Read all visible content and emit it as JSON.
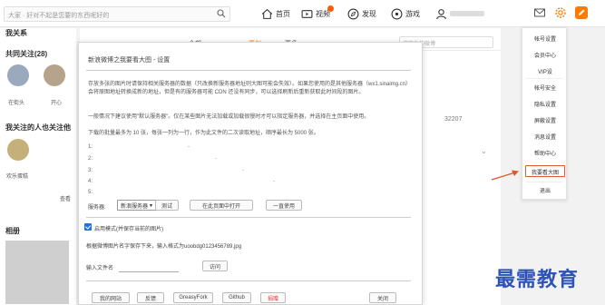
{
  "topbar": {
    "search_placeholder": "大家 · 好对不起是您要的东西呢好的",
    "nav": [
      {
        "label": "首页"
      },
      {
        "label": "视频"
      },
      {
        "label": "发现"
      },
      {
        "label": "游戏"
      }
    ]
  },
  "left": {
    "section_follow": "我关系",
    "section_common": "共同关注(28)",
    "users": [
      "在街头",
      "开心"
    ],
    "section_they": "我关注的人也关注他",
    "user3": "欢乐蛋糕",
    "more": "查看",
    "section_photos": "相册"
  },
  "bg": {
    "tabs": [
      "全部",
      "原创",
      "更多"
    ],
    "search_placeholder": "搜索他的微博",
    "like_count": "32207"
  },
  "dialog": {
    "title": "新浪微博之我要看大图 - 设置",
    "para1": "存放多张的图片时请保持相关服务器的数据（只改换新服务器地址则大图可能会失效）。如果您使用的是其他服务器（wx1.sinaimg.cn）会将原图地址转换成新的地址，但是有的服务器可能 CDN 还没有同步，可以选择刷新后重新获取此时间段的图片。",
    "para2": "一般情况下建议使用\"默认服务器\"。仅在某些图片无法加载或加载很慢时才可以指定服务器，并选择在主页面中使用。",
    "para3": "下载的批量最多为 10 张，每张一列为一行，作为此文件的二次读取地址，顺序最长为 5000 张。",
    "rows": [
      "1:",
      "2:",
      "3:",
      "4:",
      "5:"
    ],
    "server_label": "服务器:",
    "server_value": "新浪服务器",
    "btn_test": "测试",
    "btn_open_new": "在此页面中打开",
    "btn_use": "一直使用",
    "checkbox_label": "启用模式(并保存当前的图片)",
    "filename_note": "根据微博图片名字保存下来，输入格式为uoobdg0123456789.jpg",
    "filename_label": "输入文件名",
    "btn_access": "访问",
    "footer": [
      "我的网站",
      "反馈",
      "GreasyFork",
      "Github",
      "捐赠",
      "关闭"
    ]
  },
  "menu": {
    "items": [
      "帐号设置",
      "会员中心",
      "VIP设",
      "帐号安全",
      "隐私设置",
      "屏蔽设置",
      "消息设置",
      "帮助中心",
      "我要看大图",
      "退出"
    ],
    "highlight_index": 8
  },
  "watermark": "最需教育",
  "colors": {
    "accent": "#ff7a00",
    "highlight": "#e0582d",
    "watermark": "#2d53b8"
  }
}
